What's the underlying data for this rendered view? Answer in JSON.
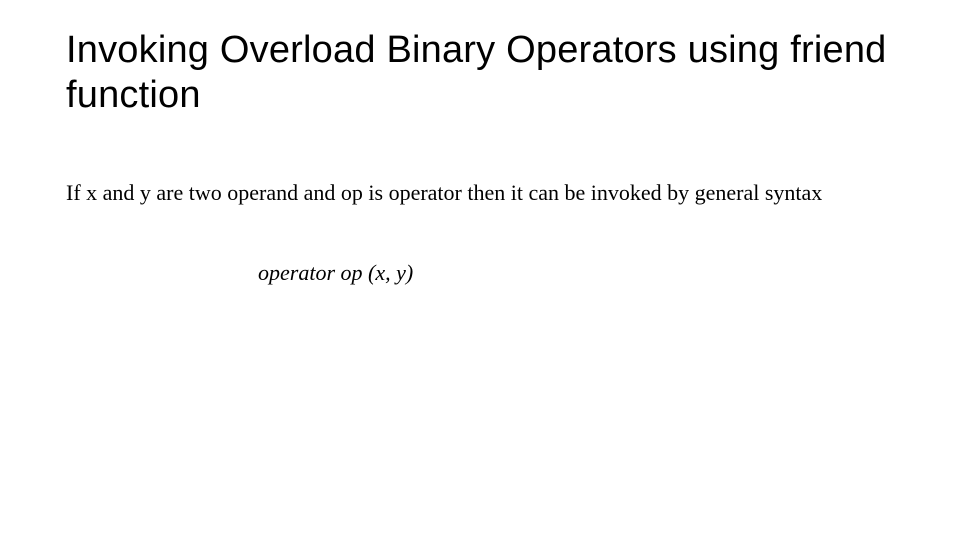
{
  "title": "Invoking Overload Binary Operators using friend function",
  "body": "If x and y are two operand and op is operator then it can be invoked by general syntax",
  "syntax": "operator op (x, y)"
}
